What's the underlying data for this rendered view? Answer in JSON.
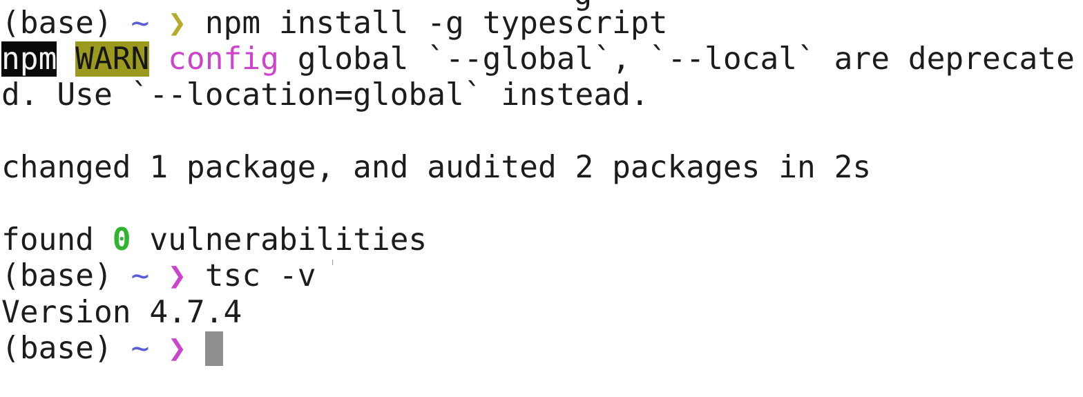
{
  "terminal": {
    "partial_top_line": "                               g",
    "prompt": {
      "env": "(base)",
      "tilde": "~",
      "chevron": "❯"
    },
    "lines": {
      "cmd_install": "npm install -g typescript",
      "warn_npm": "npm",
      "warn_level": "WARN",
      "warn_config": "config",
      "warn_message_1": "global `--global`, `--local` are deprecate",
      "warn_message_2": "d. Use `--location=global` instead.",
      "changed_summary": "changed 1 package, and audited 2 packages in 2s",
      "found_prefix": "found",
      "found_count": "0",
      "found_suffix": "vulnerabilities",
      "cmd_tsc": "tsc -v",
      "version_output": "Version 4.7.4"
    },
    "colors": {
      "background": "#ffffff",
      "text": "#1c1c1c",
      "tilde": "#5a5cd6",
      "chevron_first": "#b5ad2a",
      "chevron_other": "#cc44cc",
      "npm_badge_bg": "#0a0a0a",
      "warn_badge_bg": "#9c9a1e",
      "config_text": "#cc44cc",
      "zero_count": "#2fb52f",
      "cursor": "#8f8f8f"
    },
    "mouse_cursor_icon": "ibeam-cursor-icon"
  }
}
